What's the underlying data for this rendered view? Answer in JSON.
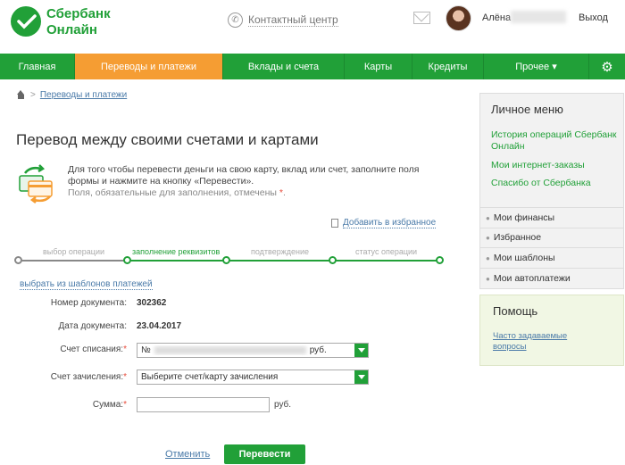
{
  "header": {
    "logo_line1": "Сбербанк",
    "logo_line2": "Онлайн",
    "contact_label": "Контактный центр",
    "username": "Алёна",
    "logout_label": "Выход"
  },
  "nav": {
    "items": [
      {
        "label": "Главная"
      },
      {
        "label": "Переводы и платежи"
      },
      {
        "label": "Вклады и счета"
      },
      {
        "label": "Карты"
      },
      {
        "label": "Кредиты"
      },
      {
        "label": "Прочее ▾"
      }
    ]
  },
  "breadcrumb": {
    "link": "Переводы и платежи",
    "sep": ">"
  },
  "page": {
    "title": "Перевод между своими счетами и картами",
    "info": "Для того чтобы перевести деньги на свою карту, вклад или счет, заполните поля формы и нажмите на кнопку «Перевести».",
    "note": "Поля, обязательные для заполнения, отмечены",
    "note_star": "*",
    "note_end": ".",
    "favorite_label": "Добавить в избранное",
    "templates_label": "выбрать из шаблонов платежей"
  },
  "stepper": {
    "steps": [
      {
        "label": "выбор операции"
      },
      {
        "label": "заполнение реквизитов"
      },
      {
        "label": "подтверждение"
      },
      {
        "label": "статус операции"
      }
    ]
  },
  "form": {
    "doc_number_label": "Номер документа:",
    "doc_number_value": "302362",
    "doc_date_label": "Дата документа:",
    "doc_date_value": "23.04.2017",
    "debit_label": "Счет списания:",
    "debit_value_prefix": "№",
    "debit_value_suffix": "руб.",
    "credit_label": "Счет зачисления:",
    "credit_placeholder": "Выберите счет/карту зачисления",
    "amount_label": "Сумма:",
    "amount_value": "",
    "currency": "руб.",
    "required_mark": "*"
  },
  "actions": {
    "cancel_label": "Отменить",
    "submit_label": "Перевести"
  },
  "sidebar": {
    "title": "Личное меню",
    "links": [
      {
        "label": "История операций Сбербанк Онлайн"
      },
      {
        "label": "Мои интернет-заказы"
      },
      {
        "label": "Спасибо от Сбербанка"
      }
    ],
    "sub_items": [
      {
        "label": "Мои финансы"
      },
      {
        "label": "Избранное"
      },
      {
        "label": "Мои шаблоны"
      },
      {
        "label": "Мои автоплатежи"
      }
    ],
    "help_title": "Помощь",
    "help_link": "Часто задаваемые вопросы"
  },
  "colors": {
    "brand_green": "#21a038",
    "active_orange": "#f59d33",
    "link_blue": "#4a7aa8"
  }
}
